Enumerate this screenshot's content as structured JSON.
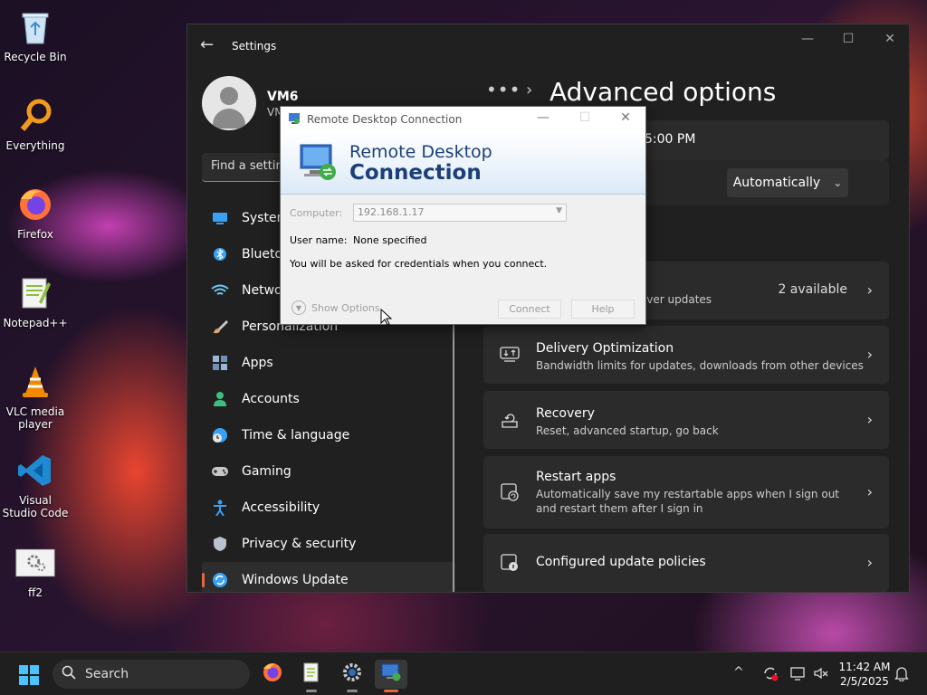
{
  "desktop": {
    "icons": [
      {
        "label": "Recycle Bin"
      },
      {
        "label": "Everything"
      },
      {
        "label": "Firefox"
      },
      {
        "label": "Notepad++"
      },
      {
        "label": "VLC media player"
      },
      {
        "label": "Visual Studio Code"
      },
      {
        "label": "ff2"
      }
    ]
  },
  "settings": {
    "app_title": "Settings",
    "user": {
      "name": "VM6",
      "sub": "VM"
    },
    "search_placeholder": "Find a setting",
    "nav": [
      {
        "label": "System",
        "icon": "system-icon",
        "color": "#3aa0f3"
      },
      {
        "label": "Bluetooth & devices",
        "icon": "bluetooth-icon",
        "color": "#3aa0f3"
      },
      {
        "label": "Network & internet",
        "icon": "wifi-icon",
        "color": "#6cc6f7"
      },
      {
        "label": "Personalization",
        "icon": "brush-icon",
        "color": "#e0a46a"
      },
      {
        "label": "Apps",
        "icon": "apps-icon",
        "color": "#9bb5d6"
      },
      {
        "label": "Accounts",
        "icon": "account-icon",
        "color": "#3fbf7f"
      },
      {
        "label": "Time & language",
        "icon": "globe-clock-icon",
        "color": "#3aa0f3"
      },
      {
        "label": "Gaming",
        "icon": "gamepad-icon",
        "color": "#c7c7c7"
      },
      {
        "label": "Accessibility",
        "icon": "accessibility-icon",
        "color": "#3aa0f3"
      },
      {
        "label": "Privacy & security",
        "icon": "shield-icon",
        "color": "#b9c3cf"
      },
      {
        "label": "Windows Update",
        "icon": "update-icon",
        "color": "#3aa0f3"
      }
    ],
    "breadcrumb_dots": "•••",
    "breadcrumb_chevron": "›",
    "page_title": "Advanced options",
    "partial_row": {
      "text": "o 5:00 PM"
    },
    "auto_dropdown": {
      "label": "Automatically",
      "chevron": "⌄"
    },
    "cards": [
      {
        "title": "",
        "sub": "river updates",
        "right": "2 available",
        "chevron": "›"
      },
      {
        "title": "Delivery Optimization",
        "sub": "Bandwidth limits for updates, downloads from other devices",
        "chevron": "›"
      },
      {
        "title": "Recovery",
        "sub": "Reset, advanced startup, go back",
        "chevron": "›"
      },
      {
        "title": "Restart apps",
        "sub": "Automatically save my restartable apps when I sign out and restart them after I sign in",
        "chevron": "›"
      },
      {
        "title": "Configured update policies",
        "sub": "",
        "chevron": "›"
      }
    ]
  },
  "rdc": {
    "title": "Remote Desktop Connection",
    "banner_line1": "Remote Desktop",
    "banner_line2": "Connection",
    "computer_label": "Computer:",
    "computer_value": "192.168.1.17",
    "username_label": "User name:",
    "username_value": "None specified",
    "note": "You will be asked for credentials when you connect.",
    "show_options": "Show Options",
    "connect": "Connect",
    "help": "Help"
  },
  "taskbar": {
    "search_label": "Search",
    "apps": [
      "firefox-icon",
      "notepadpp-icon",
      "settings-gear-icon",
      "remote-desktop-icon"
    ],
    "clock_time": "11:42 AM",
    "clock_date": "2/5/2025"
  }
}
